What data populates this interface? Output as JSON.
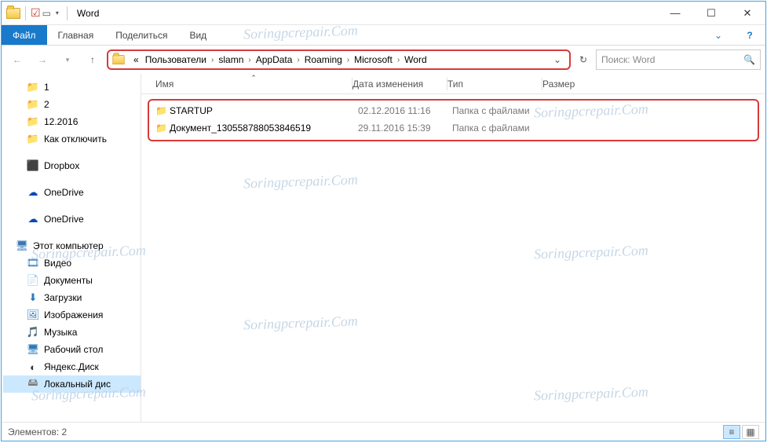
{
  "window": {
    "title": "Word"
  },
  "ribbon": {
    "file": "Файл",
    "tabs": [
      "Главная",
      "Поделиться",
      "Вид"
    ]
  },
  "breadcrumb": {
    "overflow": "«",
    "items": [
      "Пользователи",
      "slamn",
      "AppData",
      "Roaming",
      "Microsoft",
      "Word"
    ]
  },
  "search": {
    "placeholder": "Поиск: Word"
  },
  "nav": {
    "quick": [
      {
        "label": "1",
        "icon": "folder"
      },
      {
        "label": "2",
        "icon": "folder"
      },
      {
        "label": "12.2016",
        "icon": "folder"
      },
      {
        "label": "Как отключить",
        "icon": "folder"
      }
    ],
    "cloud": [
      {
        "label": "Dropbox",
        "icon": "dropbox"
      },
      {
        "label": "OneDrive",
        "icon": "onedrive"
      },
      {
        "label": "OneDrive",
        "icon": "onedrive"
      }
    ],
    "pc": {
      "label": "Этот компьютер",
      "children": [
        {
          "label": "Видео",
          "icon": "video"
        },
        {
          "label": "Документы",
          "icon": "doc"
        },
        {
          "label": "Загрузки",
          "icon": "down"
        },
        {
          "label": "Изображения",
          "icon": "pic"
        },
        {
          "label": "Музыка",
          "icon": "music"
        },
        {
          "label": "Рабочий стол",
          "icon": "desk"
        },
        {
          "label": "Яндекс.Диск",
          "icon": "ydisk"
        },
        {
          "label": "Локальный дис",
          "icon": "drive",
          "selected": true
        }
      ]
    }
  },
  "columns": {
    "name": "Имя",
    "date": "Дата изменения",
    "type": "Тип",
    "size": "Размер"
  },
  "files": [
    {
      "name": "STARTUP",
      "date": "02.12.2016 11:16",
      "type": "Папка с файлами"
    },
    {
      "name": "Документ_130558788053846519",
      "date": "29.11.2016 15:39",
      "type": "Папка с файлами"
    }
  ],
  "status": {
    "count_label": "Элементов: 2"
  },
  "watermark": "Soringpcrepair.Com"
}
